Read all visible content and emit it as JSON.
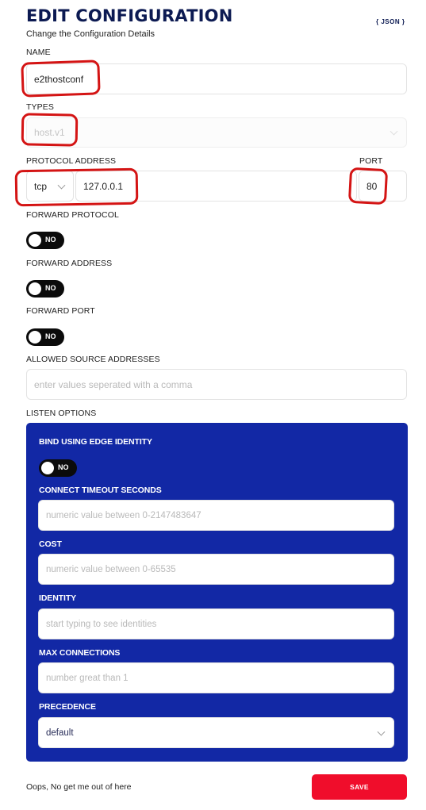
{
  "header": {
    "title": "EDIT CONFIGURATION",
    "subtitle": "Change the Configuration Details",
    "json_link": "{ JSON }"
  },
  "name": {
    "label": "NAME",
    "value": "e2thostconf"
  },
  "types": {
    "label": "TYPES",
    "value": "host.v1",
    "disabled": true
  },
  "protocol_address": {
    "label": "PROTOCOL ADDRESS",
    "protocol": "tcp",
    "address": "127.0.0.1"
  },
  "port": {
    "label": "PORT",
    "value": "80"
  },
  "forward_protocol": {
    "label": "FORWARD PROTOCOL",
    "toggle": "NO"
  },
  "forward_address": {
    "label": "FORWARD ADDRESS",
    "toggle": "NO"
  },
  "forward_port": {
    "label": "FORWARD PORT",
    "toggle": "NO"
  },
  "allowed_source": {
    "label": "ALLOWED SOURCE ADDRESSES",
    "placeholder": "enter values seperated with a comma"
  },
  "listen_options": {
    "label": "LISTEN OPTIONS",
    "bind_using_edge_identity": {
      "label": "BIND USING EDGE IDENTITY",
      "toggle": "NO"
    },
    "connect_timeout": {
      "label": "CONNECT TIMEOUT SECONDS",
      "placeholder": "numeric value between 0-2147483647"
    },
    "cost": {
      "label": "COST",
      "placeholder": "numeric value between 0-65535"
    },
    "identity": {
      "label": "IDENTITY",
      "placeholder": "start typing to see identities"
    },
    "max_connections": {
      "label": "MAX CONNECTIONS",
      "placeholder": "number great than 1"
    },
    "precedence": {
      "label": "PRECEDENCE",
      "value": "default"
    }
  },
  "footer": {
    "cancel_text": "Oops, No get me out of here",
    "save_label": "SAVE"
  },
  "colors": {
    "title": "#0c1a52",
    "panel": "#1228a5",
    "save": "#f00d2b",
    "annotation": "#d41414",
    "toggle": "#0b0b0b"
  }
}
